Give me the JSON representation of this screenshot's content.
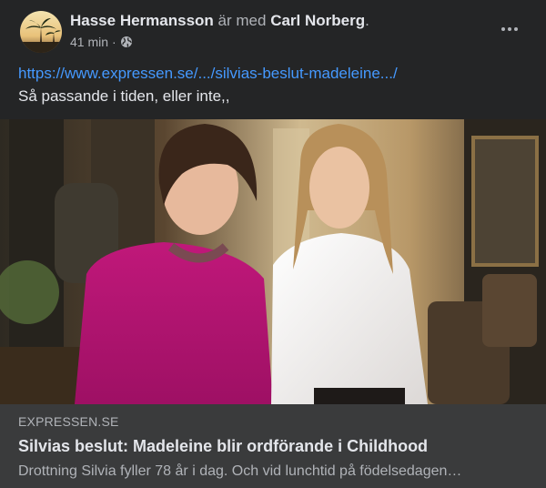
{
  "post": {
    "author": "Hasse Hermansson",
    "with_text": "är med",
    "tagged": "Carl Norberg",
    "tagged_suffix": ".",
    "time": "41 min",
    "separator": "·",
    "privacy_icon": "globe-icon",
    "more_icon": "more-options-icon",
    "link_url": "https://www.expressen.se/.../silvias-beslut-madeleine.../",
    "message": "Så passande i tiden, eller inte,,"
  },
  "link_preview": {
    "domain": "EXPRESSEN.SE",
    "title": "Silvias beslut: Madeleine blir ordförande i Childhood",
    "description": "Drottning Silvia fyller 78 år i dag. Och vid lunchtid på födelsedagen…"
  },
  "colors": {
    "background": "#242526",
    "card": "#3a3b3c",
    "link": "#4599ff",
    "text_primary": "#e4e6eb",
    "text_secondary": "#b0b3b8"
  }
}
